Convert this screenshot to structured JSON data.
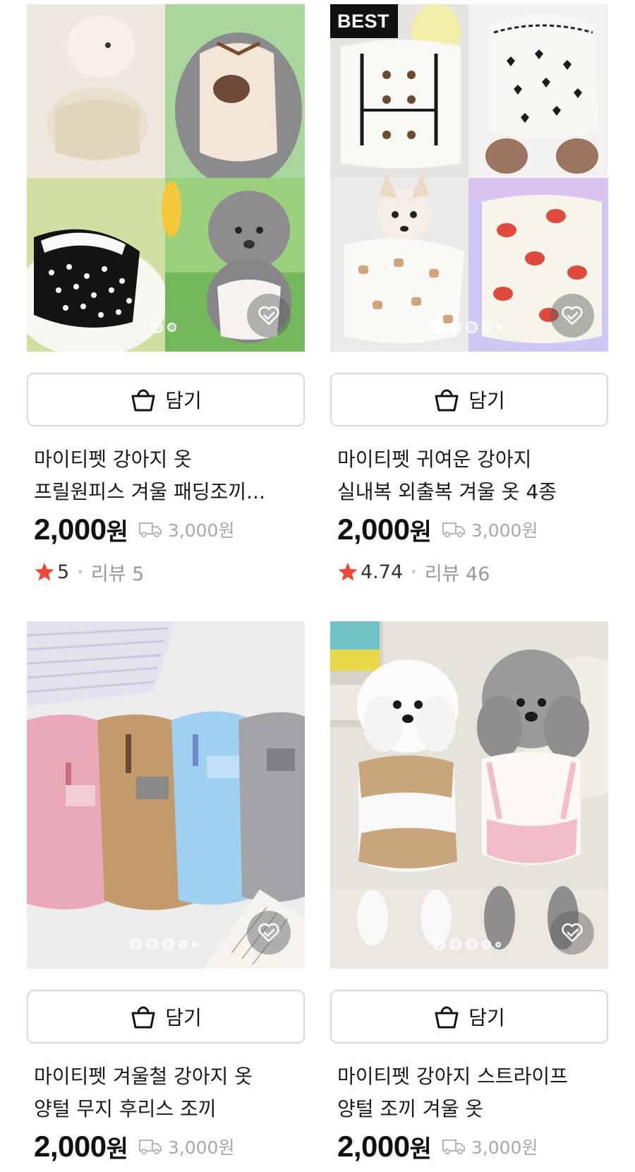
{
  "products": [
    {
      "badge": "",
      "cart_label": "담기",
      "title_line1": "마이티펫 강아지 옷",
      "title_line2": "프릴원피스 겨울 패딩조끼...",
      "price": "2,000",
      "currency": "원",
      "shipping_fee": "3,000원",
      "rating": "5",
      "review_text": "리뷰 5",
      "image_pages": 2,
      "image_current": 1
    },
    {
      "badge": "BEST",
      "cart_label": "담기",
      "title_line1": "마이티펫 귀여운 강아지",
      "title_line2": "실내복 외출복 겨울 옷 4종",
      "price": "2,000",
      "currency": "원",
      "shipping_fee": "3,000원",
      "rating": "4.74",
      "review_text": "리뷰 46",
      "image_pages": 5,
      "image_current": 1
    },
    {
      "badge": "",
      "cart_label": "담기",
      "title_line1": "마이티펫 겨울철 강아지 옷",
      "title_line2": "양털 무지 후리스 조끼",
      "price": "2,000",
      "currency": "원",
      "shipping_fee": "3,000원",
      "image_pages": 5,
      "image_current": 1
    },
    {
      "badge": "",
      "cart_label": "담기",
      "title_line1": "마이티펫 강아지 스트라이프",
      "title_line2": "양털 조끼 겨울 옷",
      "price": "2,000",
      "currency": "원",
      "shipping_fee": "3,000원",
      "image_pages": 5,
      "image_current": 1
    }
  ],
  "icons": {
    "cart": "shopping-bag-icon",
    "favorite": "heart-check-icon",
    "shipping": "delivery-truck-icon",
    "rating": "star-icon"
  },
  "colors": {
    "star": "#ee4a3a",
    "border": "#d9d9d9",
    "muted": "#a8a8a8",
    "badge_bg": "#111111"
  }
}
